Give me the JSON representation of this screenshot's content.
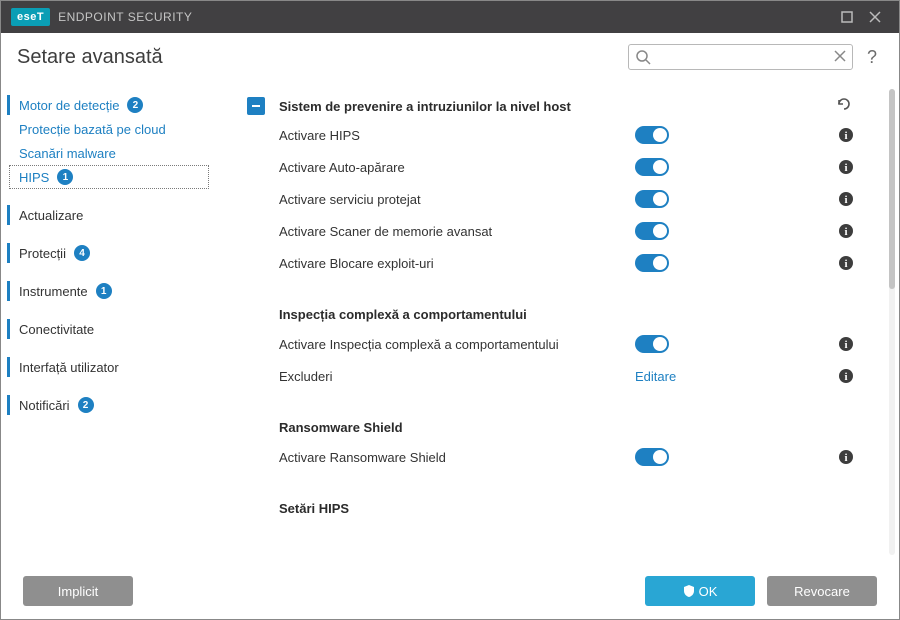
{
  "product": {
    "brand": "eseT",
    "name": "ENDPOINT SECURITY"
  },
  "page_title": "Setare avansată",
  "search": {
    "placeholder": ""
  },
  "sidebar": {
    "items": [
      {
        "label": "Motor de detecție",
        "badge": "2",
        "kind": "group",
        "bar": true,
        "child": true
      },
      {
        "label": "Protecție bazată pe cloud",
        "kind": "child",
        "child": true
      },
      {
        "label": "Scanări malware",
        "kind": "child",
        "child": true
      },
      {
        "label": "HIPS",
        "badge": "1",
        "kind": "child",
        "child": true,
        "selected": true
      },
      {
        "label": "Actualizare",
        "kind": "group",
        "bar": true
      },
      {
        "label": "Protecții",
        "badge": "4",
        "kind": "group",
        "bar": true
      },
      {
        "label": "Instrumente",
        "badge": "1",
        "kind": "group",
        "bar": true
      },
      {
        "label": "Conectivitate",
        "kind": "group",
        "bar": true
      },
      {
        "label": "Interfață utilizator",
        "kind": "group",
        "bar": true
      },
      {
        "label": "Notificări",
        "badge": "2",
        "kind": "group",
        "bar": true
      }
    ]
  },
  "section": {
    "title": "Sistem de prevenire a intruziunilor la nivel host",
    "rows": [
      {
        "label": "Activare HIPS",
        "type": "toggle",
        "on": true
      },
      {
        "label": "Activare Auto-apărare",
        "type": "toggle",
        "on": true
      },
      {
        "label": "Activare serviciu protejat",
        "type": "toggle",
        "on": true
      },
      {
        "label": "Activare Scaner de memorie avansat",
        "type": "toggle",
        "on": true
      },
      {
        "label": "Activare Blocare exploit-uri",
        "type": "toggle",
        "on": true
      }
    ],
    "sub1": {
      "heading": "Inspecția complexă a comportamentului",
      "rows": [
        {
          "label": "Activare Inspecția complexă a comportamentului",
          "type": "toggle",
          "on": true
        },
        {
          "label": "Excluderi",
          "type": "link",
          "value": "Editare"
        }
      ]
    },
    "sub2": {
      "heading": "Ransomware Shield",
      "rows": [
        {
          "label": "Activare Ransomware Shield",
          "type": "toggle",
          "on": true
        }
      ]
    },
    "sub3": {
      "heading": "Setări HIPS"
    }
  },
  "footer": {
    "default": "Implicit",
    "ok": "OK",
    "cancel": "Revocare"
  }
}
